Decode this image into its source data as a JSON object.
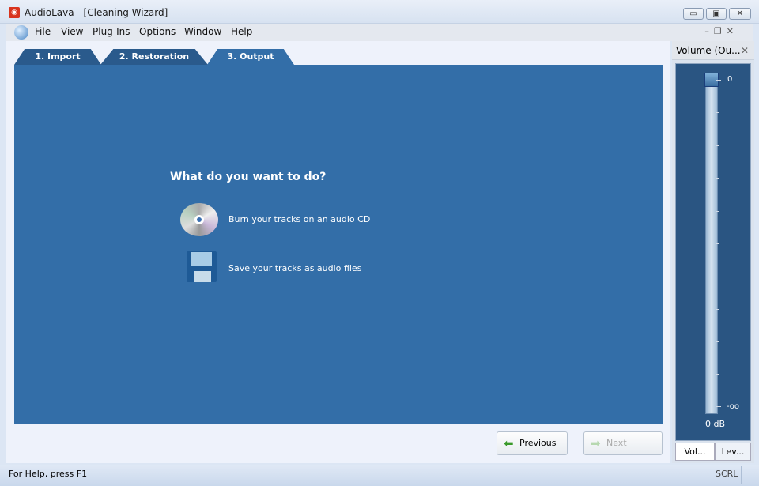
{
  "window": {
    "title": "AudioLava - [Cleaning Wizard]",
    "min": "▭",
    "max": "▣",
    "close": "✕"
  },
  "menu": [
    "File",
    "View",
    "Plug-Ins",
    "Options",
    "Window",
    "Help"
  ],
  "tabs": [
    "1. Import",
    "2. Restoration",
    "3. Output"
  ],
  "active_tab": "3. Output",
  "wizard": {
    "question": "What do you want to do?",
    "options": [
      {
        "label": "Burn your tracks on an audio CD",
        "icon": "cd-icon"
      },
      {
        "label": "Save your tracks as audio files",
        "icon": "floppy-disk-icon"
      }
    ]
  },
  "buttons": {
    "previous": "Previous",
    "next": "Next"
  },
  "volume_panel": {
    "title": "Volume (Ou...",
    "close": "✕",
    "top_label": "0",
    "bottom_label": "-oo",
    "value_label": "0 dB",
    "level_fraction": 1.0,
    "tabs": [
      "Vol...",
      "Lev..."
    ]
  },
  "status": {
    "help": "For Help, press F1",
    "scrl": "SCRL"
  },
  "colors": {
    "panel": "#336ea8",
    "tab_dark": "#2a5a8c",
    "slider_bg": "#2a5582"
  }
}
